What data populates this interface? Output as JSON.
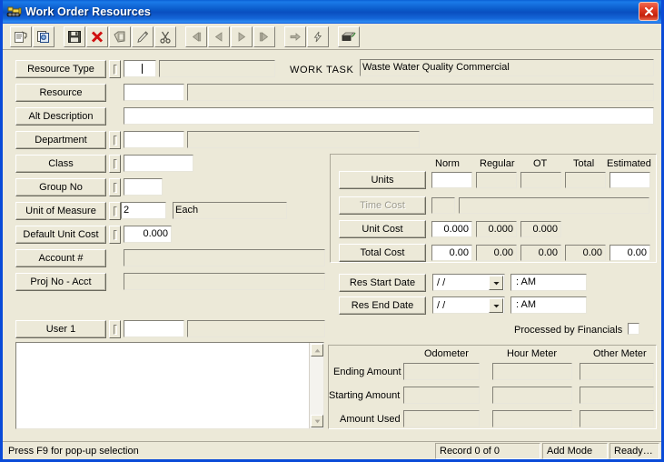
{
  "window": {
    "title": "Work Order Resources",
    "icon": "bulldozer-icon",
    "close_label": "✕",
    "accent_titlebar": "#0a4bd8",
    "close_color": "#c4210c",
    "face_color": "#ece9d8"
  },
  "toolbar": {
    "buttons": [
      {
        "name": "properties-icon",
        "title": "Properties"
      },
      {
        "name": "copy-icon",
        "title": "Copy Record"
      },
      {
        "name": "save-icon",
        "title": "Save"
      },
      {
        "name": "delete-icon",
        "title": "Delete"
      },
      {
        "name": "paste-icon",
        "title": "Paste"
      },
      {
        "name": "edit-pencil-icon",
        "title": "Edit"
      },
      {
        "name": "cut-scissors-icon",
        "title": "Cut"
      },
      {
        "name": "first-record-icon",
        "title": "First"
      },
      {
        "name": "previous-record-icon",
        "title": "Previous"
      },
      {
        "name": "next-record-icon",
        "title": "Next"
      },
      {
        "name": "last-record-icon",
        "title": "Last"
      },
      {
        "name": "goto-icon",
        "title": "Go To"
      },
      {
        "name": "lightning-icon",
        "title": "Execute"
      },
      {
        "name": "exit-door-icon",
        "title": "Exit"
      }
    ]
  },
  "work_task": {
    "label": "WORK TASK",
    "value": "Waste Water Quality Commercial"
  },
  "fields": {
    "resource_type": {
      "label": "Resource Type",
      "code": "",
      "description": ""
    },
    "resource": {
      "label": "Resource",
      "code": "",
      "description": ""
    },
    "alt_description": {
      "label": "Alt Description",
      "value": ""
    },
    "department": {
      "label": "Department",
      "code": "",
      "description": ""
    },
    "class": {
      "label": "Class",
      "code": ""
    },
    "group_no": {
      "label": "Group No",
      "code": ""
    },
    "unit_of_measure": {
      "label": "Unit of Measure",
      "code": "2",
      "description": "Each"
    },
    "default_unit_cost": {
      "label": "Default Unit Cost",
      "value": "0.000"
    },
    "account_no": {
      "label": "Account #",
      "value": ""
    },
    "proj_no_acct": {
      "label": "Proj No - Acct",
      "value": ""
    },
    "user_1": {
      "label": "User 1",
      "code": "",
      "description": ""
    },
    "notes": {
      "value": ""
    }
  },
  "cost_grid": {
    "columns": [
      "Norm",
      "Regular",
      "OT",
      "Total",
      "Estimated"
    ],
    "rows": [
      {
        "label": "Units",
        "disabled": false,
        "values": [
          "",
          "",
          "",
          "",
          ""
        ]
      },
      {
        "label": "Time Cost",
        "disabled": true,
        "values": [
          "",
          "",
          "",
          "",
          ""
        ]
      },
      {
        "label": "Unit Cost",
        "disabled": false,
        "values": [
          "0.000",
          "0.000",
          "0.000",
          "",
          ""
        ]
      },
      {
        "label": "Total Cost",
        "disabled": false,
        "values": [
          "0.00",
          "0.00",
          "0.00",
          "0.00",
          "0.00"
        ]
      }
    ]
  },
  "dates": {
    "res_start": {
      "label": "Res Start Date",
      "date": "/  /",
      "time": ":     AM"
    },
    "res_end": {
      "label": "Res End Date",
      "date": "/  /",
      "time": ":     AM"
    }
  },
  "processed": {
    "label": "Processed by Financials",
    "checked": false
  },
  "meters": {
    "columns": [
      "Odometer",
      "Hour Meter",
      "Other Meter"
    ],
    "rows": [
      {
        "label": "Ending Amount",
        "values": [
          "",
          "",
          ""
        ]
      },
      {
        "label": "Starting Amount",
        "values": [
          "",
          "",
          ""
        ]
      },
      {
        "label": "Amount Used",
        "values": [
          "",
          "",
          ""
        ]
      }
    ]
  },
  "statusbar": {
    "hint": "Press F9 for pop-up selection",
    "record": "Record 0 of 0",
    "mode": "Add Mode",
    "state": "Ready…"
  }
}
